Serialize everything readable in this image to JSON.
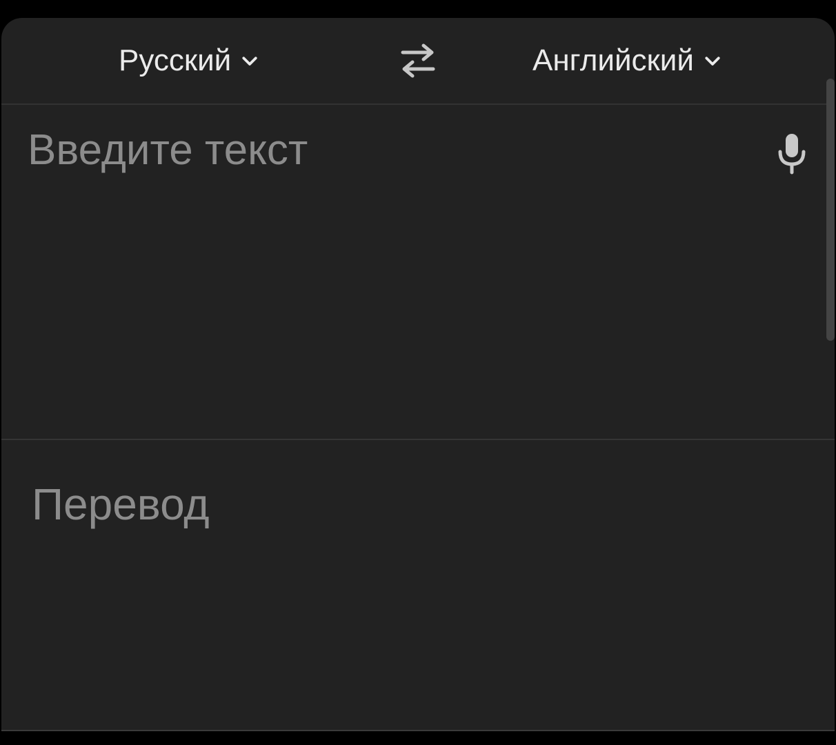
{
  "languages": {
    "source": "Русский",
    "target": "Английский"
  },
  "input": {
    "placeholder": "Введите текст"
  },
  "output": {
    "placeholder": "Перевод"
  },
  "icons": {
    "swap": "swap-arrows-icon",
    "mic": "microphone-icon",
    "dropdown": "chevron-down-icon"
  },
  "colors": {
    "background": "#222222",
    "text_primary": "#ebebeb",
    "text_placeholder": "#8c8c8c"
  }
}
